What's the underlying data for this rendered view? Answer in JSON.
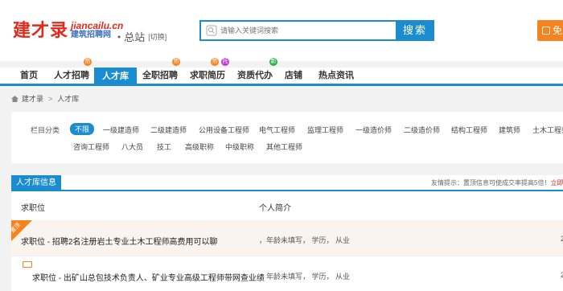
{
  "header": {
    "logo_cn": "建才录",
    "logo_en": "jiancailu.cn",
    "logo_sub": "建筑招聘网",
    "station_dot": "•",
    "station_name": "总站",
    "station_switch": "[切换]",
    "search_placeholder": "请输入关键词搜索",
    "search_button": "搜索",
    "post_button": "免"
  },
  "nav": {
    "items": [
      {
        "label": "首页"
      },
      {
        "label": "人才招聘",
        "badge": "热"
      },
      {
        "label": "人才库"
      },
      {
        "label": "全职招聘",
        "badge": "热"
      },
      {
        "label": "求职简历",
        "badge": "热"
      },
      {
        "label": "资质代办",
        "badge": "托"
      },
      {
        "label": "店铺",
        "badge": "新"
      },
      {
        "label": "热点资讯"
      }
    ],
    "badge_colors": {
      "hot": "#f7831f",
      "tuo": "#c23ad1",
      "new": "#2fb24a"
    },
    "accent": "#1a8ccf"
  },
  "breadcrumb": {
    "home": "建才录",
    "sep": ">",
    "current": "人才库"
  },
  "categories": {
    "label": "栏目分类",
    "items": [
      "不限",
      "一级建造师",
      "二级建造师",
      "公用设备工程师",
      "电气工程师",
      "监理工程师",
      "一级造价师",
      "二级造价师",
      "结构工程师",
      "建筑师",
      "土木工程师",
      "咨询工程师",
      "八大员",
      "技工",
      "高级职称",
      "中级职称",
      "其他工程师"
    ]
  },
  "talent": {
    "tab": "人才库信息",
    "tip_prefix": "友情提示：置顶信息可使成交率提高5倍！",
    "tip_link": "立即发布",
    "col_position": "求职位",
    "col_intro": "个人简介",
    "rows": [
      {
        "corner": "置顶",
        "title": "求职位 - 招聘2名注册岩土专业土木工程师高费用可以聊",
        "info": "，年龄未填写， 学历， 从业",
        "num": "2"
      },
      {
        "title": "求职位 - 出矿山总包技术负责人、矿业专业高级工程师带网查业绩",
        "info": "，年龄未填写， 学历， 从业",
        "num": "2"
      }
    ]
  }
}
